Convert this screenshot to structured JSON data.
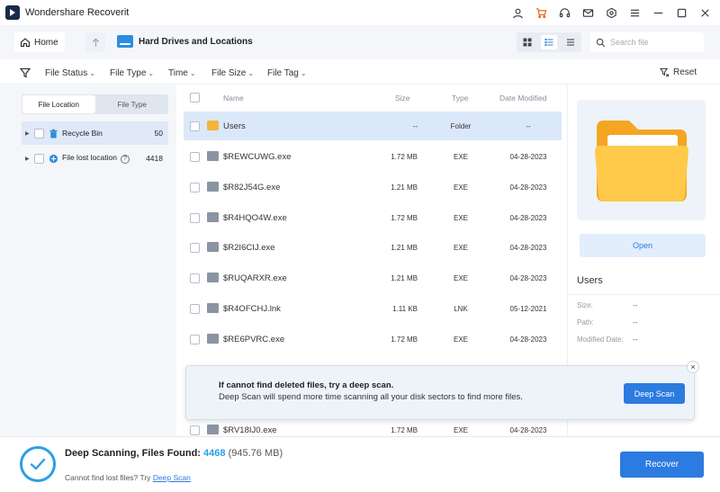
{
  "app": {
    "title": "Wondershare Recoverit",
    "titlebar_icons": [
      "user-icon",
      "cart-icon",
      "headset-icon",
      "mail-icon",
      "settings-icon",
      "menu-icon",
      "minimize-icon",
      "maximize-icon",
      "close-icon"
    ]
  },
  "nav": {
    "home_label": "Home",
    "location_title": "Hard Drives and Locations",
    "search_placeholder": "Search file"
  },
  "filters": {
    "items": [
      "File Status",
      "File Type",
      "Time",
      "File Size",
      "File Tag"
    ],
    "reset_label": "Reset"
  },
  "sidebar": {
    "tabs": [
      "File Location",
      "File Type"
    ],
    "active_tab": "File Location",
    "items": [
      {
        "label": "Recycle Bin",
        "count": "50",
        "selected": true
      },
      {
        "label": "File lost location",
        "count": "4418",
        "selected": false
      }
    ]
  },
  "table": {
    "columns": [
      "Name",
      "Size",
      "Type",
      "Date Modified"
    ],
    "rows": [
      {
        "name": "Users",
        "size": "--",
        "type": "Folder",
        "date": "--",
        "selected": true,
        "icon": "folder-icon"
      },
      {
        "name": "$REWCUWG.exe",
        "size": "1.72 MB",
        "type": "EXE",
        "date": "04-28-2023",
        "icon": "file-icon"
      },
      {
        "name": "$R82J54G.exe",
        "size": "1.21 MB",
        "type": "EXE",
        "date": "04-28-2023",
        "icon": "file-icon"
      },
      {
        "name": "$R4HQO4W.exe",
        "size": "1.72 MB",
        "type": "EXE",
        "date": "04-28-2023",
        "icon": "file-icon"
      },
      {
        "name": "$R2I6CIJ.exe",
        "size": "1.21 MB",
        "type": "EXE",
        "date": "04-28-2023",
        "icon": "file-icon"
      },
      {
        "name": "$RUQARXR.exe",
        "size": "1.21 MB",
        "type": "EXE",
        "date": "04-28-2023",
        "icon": "file-icon"
      },
      {
        "name": "$R4OFCHJ.lnk",
        "size": "1.11 KB",
        "type": "LNK",
        "date": "05-12-2021",
        "icon": "file-icon"
      },
      {
        "name": "$RE6PVRC.exe",
        "size": "1.72 MB",
        "type": "EXE",
        "date": "04-28-2023",
        "icon": "file-icon"
      },
      {
        "name": "$RV18IJ0.exe",
        "size": "1.72 MB",
        "type": "EXE",
        "date": "04-28-2023",
        "icon": "file-icon"
      }
    ]
  },
  "preview": {
    "open_label": "Open",
    "title": "Users",
    "size_label": "Size:",
    "size_value": "--",
    "path_label": "Path:",
    "path_value": "--",
    "modified_label": "Modified Date:",
    "modified_value": "--"
  },
  "popup": {
    "title": "If cannot find deleted files, try a deep scan.",
    "text": "Deep Scan will spend more time scanning all your disk sectors to find more files.",
    "button_label": "Deep Scan",
    "close_label": "×"
  },
  "status": {
    "label": "Deep Scanning, Files Found:",
    "count": "4468",
    "size": "(945.76 MB)",
    "cannot_find_text": "Cannot find lost files? Try",
    "deep_scan_link": "Deep Scan",
    "recover_label": "Recover"
  },
  "colors": {
    "accent": "#2c7be0",
    "selection": "#dbe8fa",
    "folder": "#f5b33a"
  }
}
